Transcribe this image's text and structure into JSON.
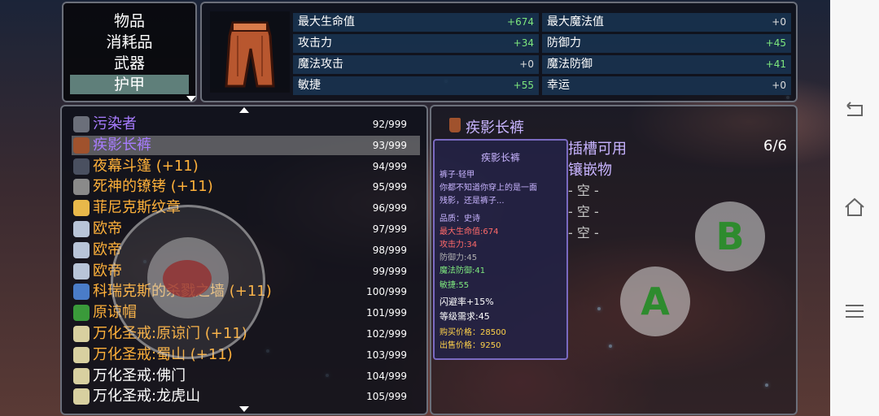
{
  "categories": {
    "items": [
      "物品",
      "消耗品",
      "武器",
      "护甲"
    ],
    "selected": "护甲"
  },
  "stats": [
    {
      "label": "最大生命值",
      "value": "+674"
    },
    {
      "label": "攻击力",
      "value": "+34"
    },
    {
      "label": "魔法攻击",
      "value": "+0"
    },
    {
      "label": "敏捷",
      "value": "+55"
    },
    {
      "label": "最大魔法值",
      "value": "+0"
    },
    {
      "label": "防御力",
      "value": "+45"
    },
    {
      "label": "魔法防御",
      "value": "+41"
    },
    {
      "label": "幸运",
      "value": "+0"
    }
  ],
  "inventory": [
    {
      "name": "污染者",
      "count": "92/999",
      "color": "#a87cff",
      "icon": "wand-icon"
    },
    {
      "name": "疾影长裤",
      "count": "93/999",
      "color": "#a87cff",
      "icon": "pants-icon"
    },
    {
      "name": "夜幕斗篷 (+11)",
      "count": "94/999",
      "color": "#ffb13a",
      "icon": "cloak-icon"
    },
    {
      "name": "死神的镣铐 (+11)",
      "count": "95/999",
      "color": "#ffb13a",
      "icon": "shackle-icon"
    },
    {
      "name": "菲尼克斯纹章",
      "count": "96/999",
      "color": "#ffb13a",
      "icon": "emblem-icon"
    },
    {
      "name": "欧帝",
      "count": "97/999",
      "color": "#ffb13a",
      "icon": "boot-icon"
    },
    {
      "name": "欧帝",
      "count": "98/999",
      "color": "#ffb13a",
      "icon": "boot-icon"
    },
    {
      "name": "欧帝",
      "count": "99/999",
      "color": "#ffb13a",
      "icon": "boot-icon"
    },
    {
      "name": "科瑞克斯的杀戮之墙 (+11)",
      "count": "100/999",
      "color": "#ffb13a",
      "icon": "ring-icon"
    },
    {
      "name": "原谅帽",
      "count": "101/999",
      "color": "#ffb13a",
      "icon": "hat-icon"
    },
    {
      "name": "万化圣戒:原谅门 (+11)",
      "count": "102/999",
      "color": "#ffb13a",
      "icon": "holy-ring-icon"
    },
    {
      "name": "万化圣戒:蜀山 (+11)",
      "count": "103/999",
      "color": "#ffb13a",
      "icon": "holy-ring-icon"
    },
    {
      "name": "万化圣戒:佛门",
      "count": "104/999",
      "color": "#ffffff",
      "icon": "holy-ring-icon"
    },
    {
      "name": "万化圣戒:龙虎山",
      "count": "105/999",
      "color": "#ffffff",
      "icon": "holy-ring-icon"
    }
  ],
  "detail": {
    "title": "疾影长裤",
    "tooltip": {
      "title": "疾影长裤",
      "type": "裤子·轻甲",
      "desc1": "你都不知道你穿上的是一面",
      "desc2": "残影，还是裤子...",
      "quality": "品质：史诗",
      "hp": "最大生命值:674",
      "atk": "攻击力:34",
      "def": "防御力:45",
      "mdef": "魔法防御:41",
      "agi": "敏捷:55",
      "dodge": "闪避率+15%",
      "level": "等级需求:45",
      "buy": "购买价格：28500",
      "sell": "出售价格：9250"
    },
    "socket_label": "插槽可用",
    "socket_count": "6/6",
    "inlay_label": "镶嵌物",
    "slots": [
      "- 空 -",
      "- 空 -",
      "- 空 -"
    ]
  },
  "controls": {
    "button_a": "A",
    "button_b": "B"
  }
}
